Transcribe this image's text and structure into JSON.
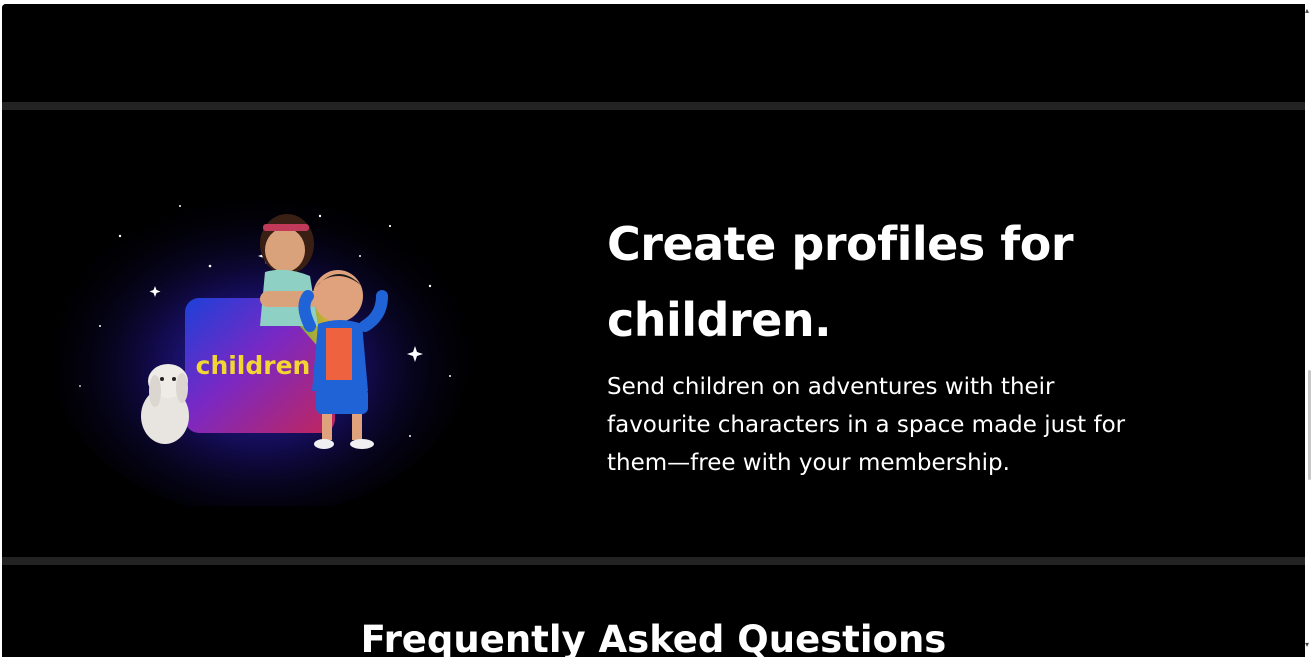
{
  "feature": {
    "headline": "Create profiles for children.",
    "description": "Send children on adventures with their favourite characters in a space made just for them—free with your membership.",
    "image_badge": "children"
  },
  "faq": {
    "title": "Frequently Asked Questions"
  },
  "colors": {
    "background": "#000000",
    "divider": "#232323",
    "text": "#ffffff",
    "badge_text": "#f2d632"
  }
}
